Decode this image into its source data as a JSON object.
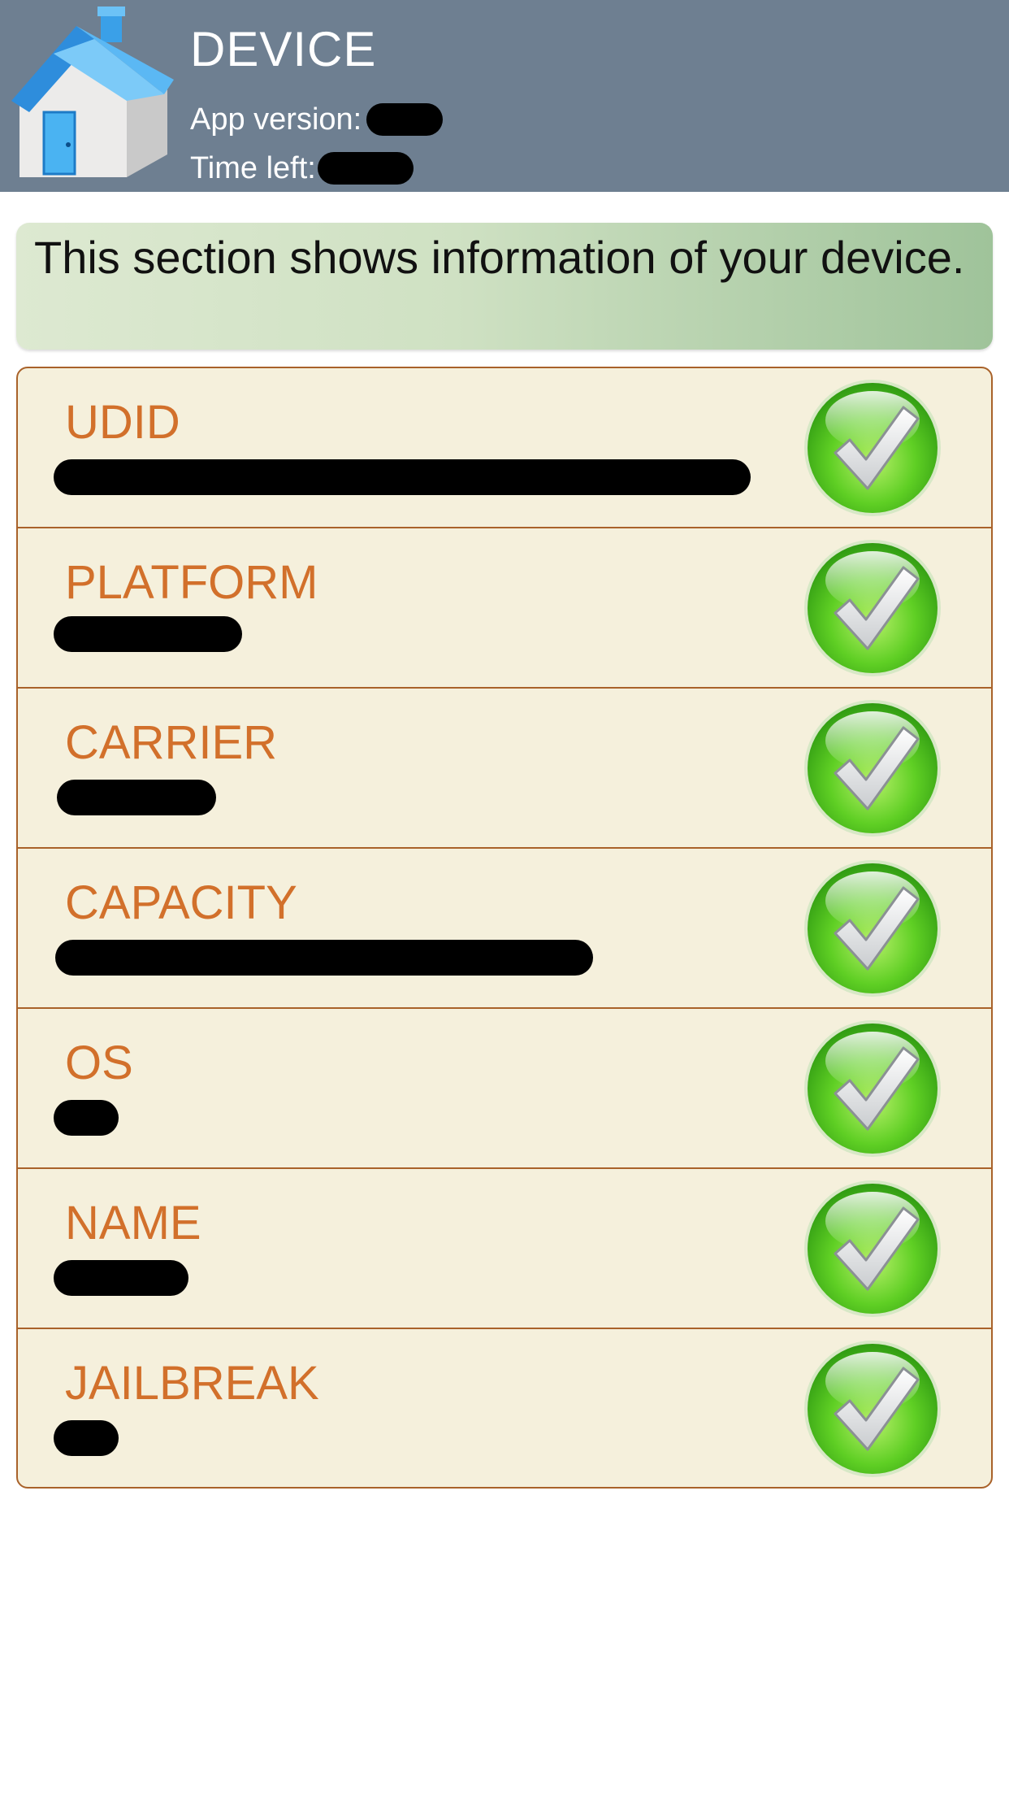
{
  "header": {
    "title": "DEVICE",
    "app_version_label": "App version:",
    "time_left_label": "Time left:"
  },
  "banner": {
    "text": "This section shows information of your device."
  },
  "rows": [
    {
      "label": "UDID"
    },
    {
      "label": "PLATFORM"
    },
    {
      "label": "CARRIER"
    },
    {
      "label": "CAPACITY"
    },
    {
      "label": "OS"
    },
    {
      "label": "NAME"
    },
    {
      "label": "JAILBREAK"
    }
  ],
  "icons": {
    "home": "house-icon",
    "status": "checkmark-icon"
  },
  "colors": {
    "header_bg": "#6e7f91",
    "label_orange": "#d2702b",
    "row_bg": "#f5f0dc",
    "border_brown": "#a9622a",
    "check_green": "#4fc21e"
  }
}
